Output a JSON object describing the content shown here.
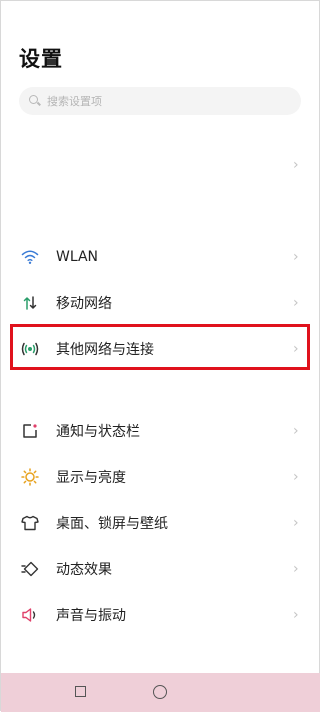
{
  "header": {
    "title": "设置"
  },
  "search": {
    "placeholder": "搜索设置项"
  },
  "chevron": "›",
  "settings": [
    {
      "label": "WLAN",
      "icon": "wifi-icon",
      "color": "#3a7bd5"
    },
    {
      "label": "移动网络",
      "icon": "mobile-data-icon",
      "color": "#2a9d6a"
    },
    {
      "label": "其他网络与连接",
      "icon": "connection-icon",
      "color": "#2a9d6a"
    },
    {
      "label": "通知与状态栏",
      "icon": "notification-icon",
      "color": "#e0406a"
    },
    {
      "label": "显示与亮度",
      "icon": "brightness-icon",
      "color": "#e7a21f"
    },
    {
      "label": "桌面、锁屏与壁纸",
      "icon": "wallpaper-icon",
      "color": "#333333"
    },
    {
      "label": "动态效果",
      "icon": "animation-icon",
      "color": "#333333"
    },
    {
      "label": "声音与振动",
      "icon": "sound-icon",
      "color": "#e0406a"
    }
  ],
  "highlight_color": "#e0121c",
  "nav": {
    "background": "#efcfd8"
  }
}
